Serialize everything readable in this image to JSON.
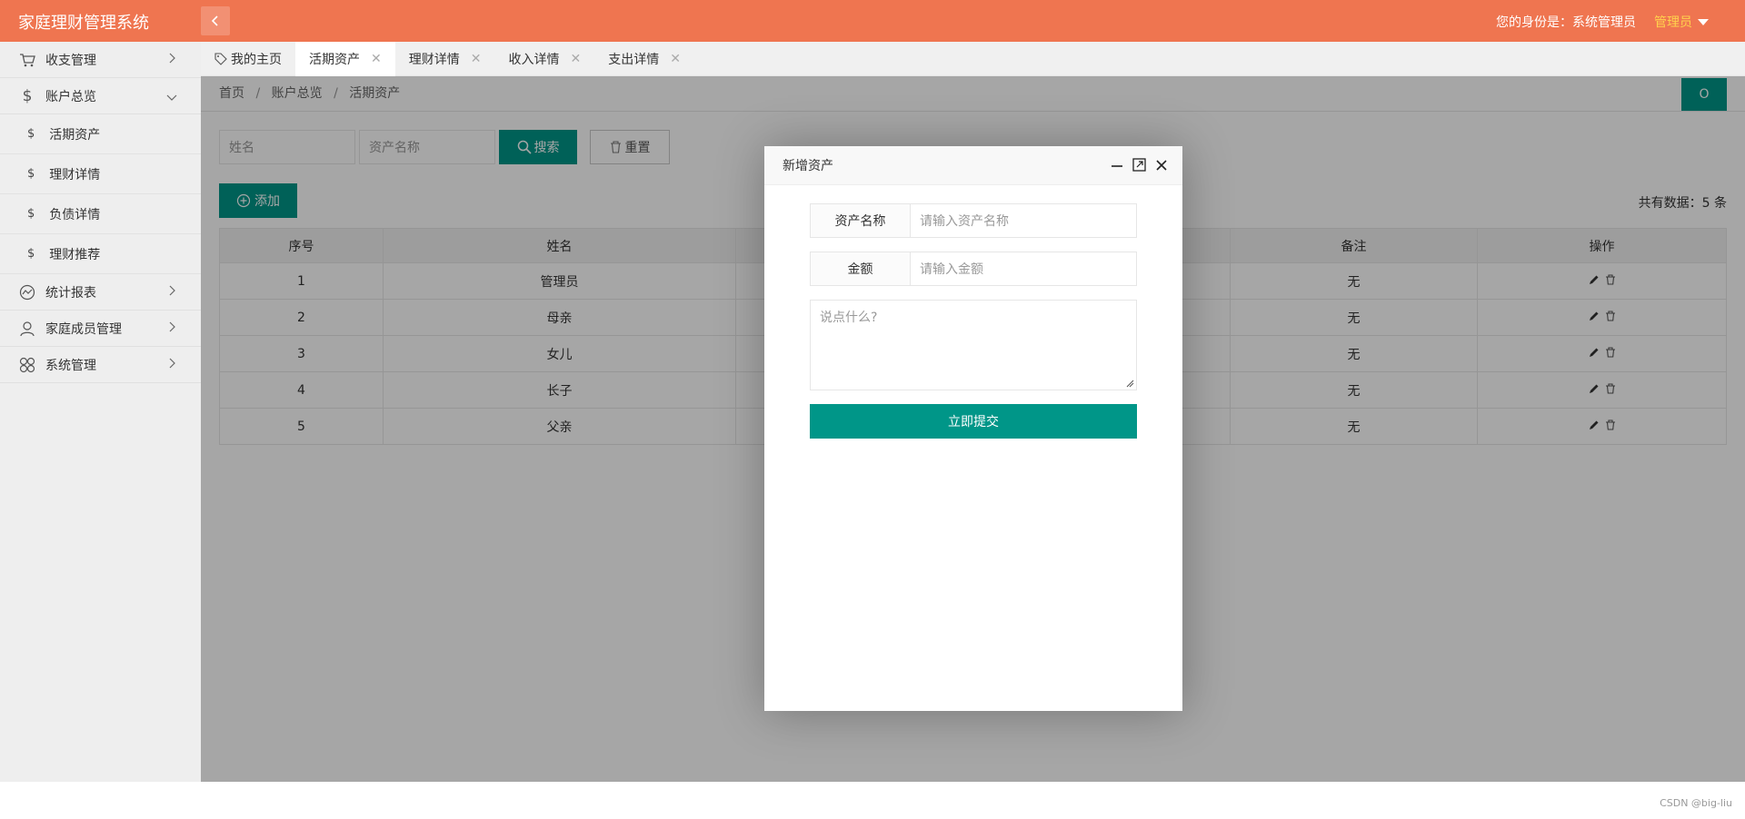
{
  "header": {
    "brand": "家庭理财管理系统",
    "identity_label": "您的身份是：系统管理员",
    "user_role": "管理员"
  },
  "sidebar": {
    "items": [
      {
        "label": "收支管理",
        "icon": "cart-icon"
      },
      {
        "label": "账户总览",
        "icon": "dollar-icon"
      },
      {
        "label": "统计报表",
        "icon": "chart-icon"
      },
      {
        "label": "家庭成员管理",
        "icon": "user-icon"
      },
      {
        "label": "系统管理",
        "icon": "flower-icon"
      }
    ],
    "sub_items": [
      "活期资产",
      "理财详情",
      "负债详情",
      "理财推荐"
    ],
    "sub_icon": "$"
  },
  "tabs": [
    {
      "label": "我的主页"
    },
    {
      "label": "活期资产"
    },
    {
      "label": "理财详情"
    },
    {
      "label": "收入详情"
    },
    {
      "label": "支出详情"
    }
  ],
  "breadcrumb": {
    "home": "首页",
    "parent": "账户总览",
    "current": "活期资产",
    "sep": "/"
  },
  "refresh_label": "O",
  "search": {
    "name_placeholder": "姓名",
    "asset_placeholder": "资产名称",
    "search_label": "搜索",
    "reset_label": "重置"
  },
  "add_label": "添加",
  "total_label": "共有数据：5 条",
  "table": {
    "headers": [
      "序号",
      "姓名",
      "",
      "",
      "备注",
      "操作"
    ],
    "rows": [
      {
        "index": "1",
        "name": "管理员",
        "remark": "无"
      },
      {
        "index": "2",
        "name": "母亲",
        "remark": "无"
      },
      {
        "index": "3",
        "name": "女儿",
        "remark": "无"
      },
      {
        "index": "4",
        "name": "长子",
        "remark": "无"
      },
      {
        "index": "5",
        "name": "父亲",
        "remark": "无"
      }
    ]
  },
  "modal": {
    "title": "新增资产",
    "asset_name_label": "资产名称",
    "asset_name_placeholder": "请输入资产名称",
    "amount_label": "金额",
    "amount_placeholder": "请输入金额",
    "textarea_placeholder": "说点什么?",
    "submit_label": "立即提交"
  },
  "watermark": "CSDN @big-liu",
  "colors": {
    "header": "#ef7550",
    "primary": "#009688",
    "role": "#ffd24d"
  }
}
